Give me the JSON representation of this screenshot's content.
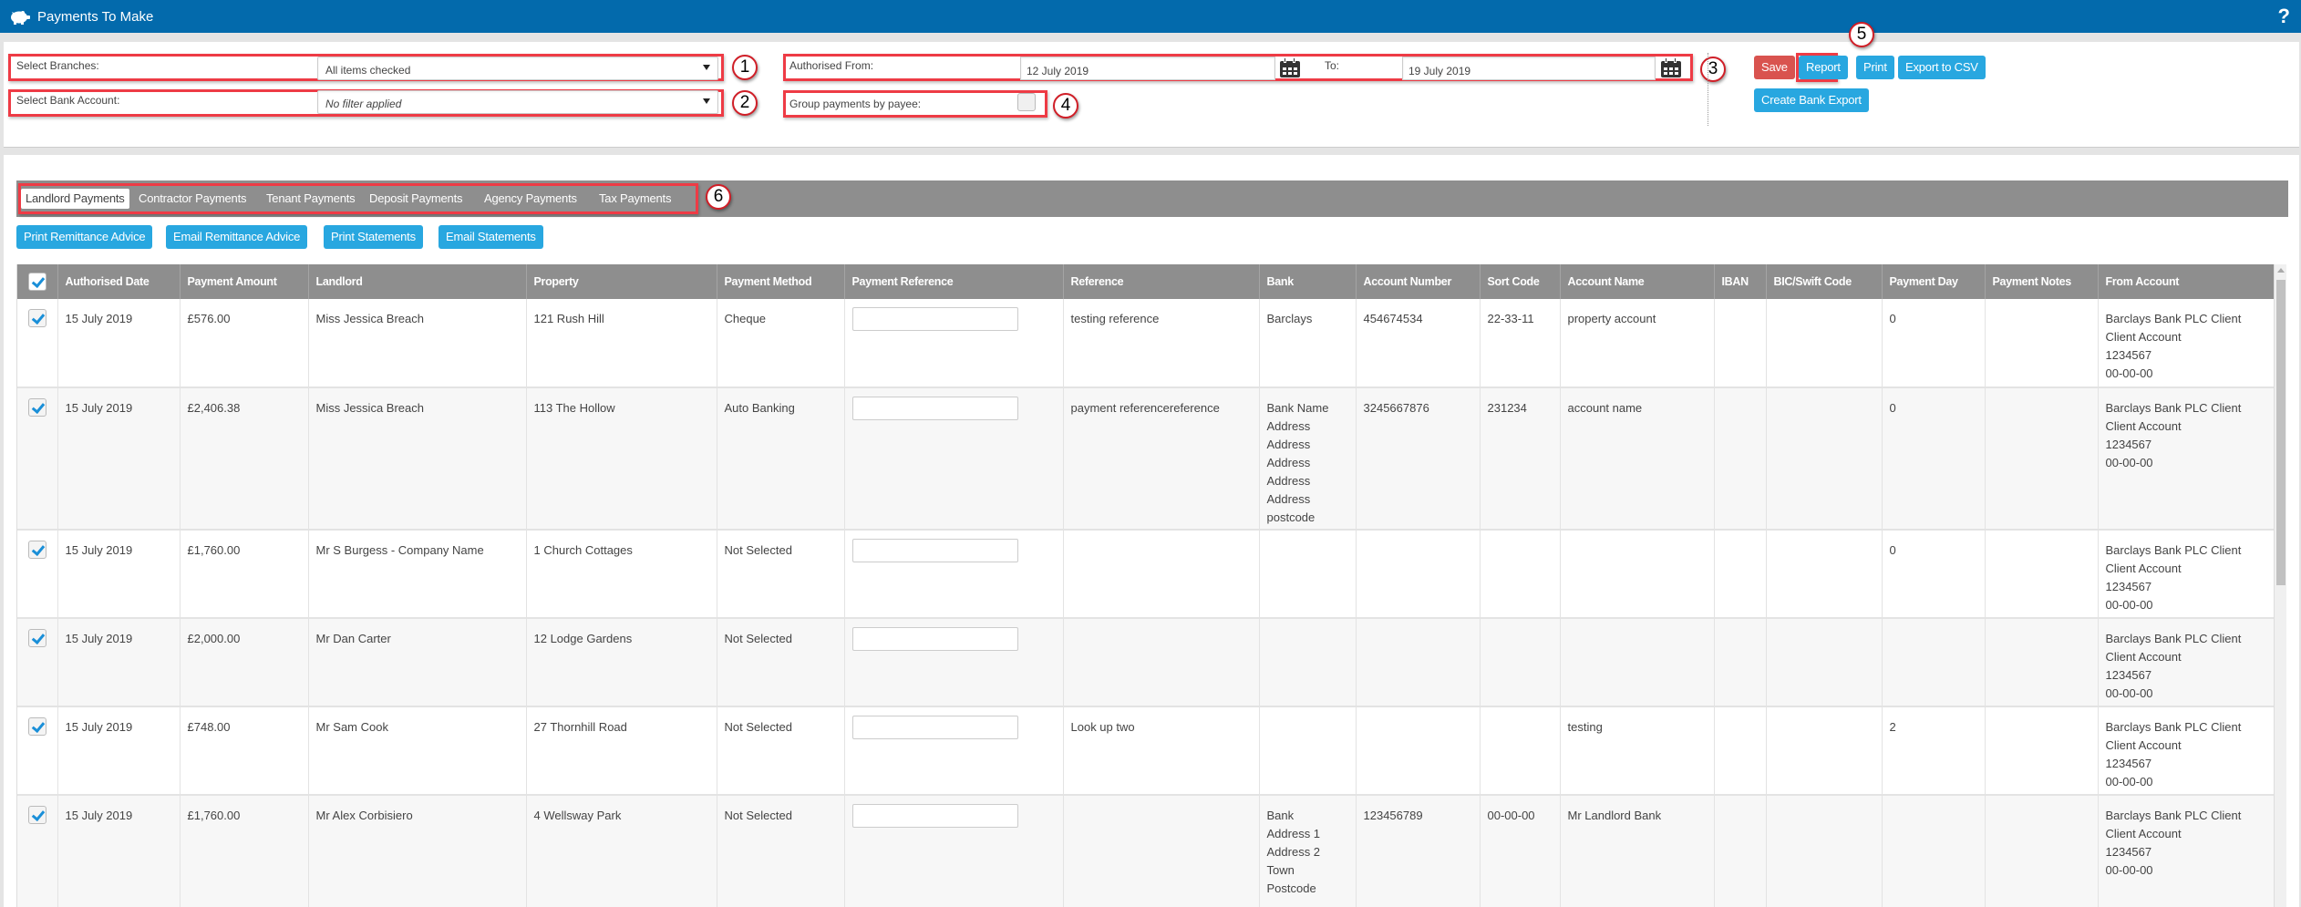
{
  "header": {
    "title": "Payments To Make",
    "app_icon": "piggy-bank-icon",
    "help_label": "?"
  },
  "filters": {
    "branches_label": "Select Branches:",
    "branches_value": "All items checked",
    "bank_account_label": "Select Bank Account:",
    "bank_account_value": "No filter applied",
    "authorised_from_label": "Authorised From:",
    "authorised_from_value": "12 July 2019",
    "to_label": "To:",
    "to_value": "19 July 2019",
    "group_by_payee_label": "Group payments by payee:",
    "group_by_payee_checked": false
  },
  "toolbar": {
    "save": "Save",
    "report": "Report",
    "print": "Print",
    "export_csv": "Export to CSV",
    "create_bank_export": "Create Bank Export"
  },
  "annotations": [
    "1",
    "2",
    "3",
    "4",
    "5",
    "6"
  ],
  "tabs": [
    {
      "label": "Landlord Payments",
      "active": true
    },
    {
      "label": "Contractor Payments",
      "active": false
    },
    {
      "label": "Tenant Payments",
      "active": false
    },
    {
      "label": "Deposit Payments",
      "active": false
    },
    {
      "label": "Agency Payments",
      "active": false
    },
    {
      "label": "Tax Payments",
      "active": false
    }
  ],
  "actions": {
    "print_remittance": "Print Remittance Advice",
    "email_remittance": "Email Remittance Advice",
    "print_statements": "Print Statements",
    "email_statements": "Email Statements"
  },
  "table": {
    "columns": [
      "Authorised Date",
      "Payment Amount",
      "Landlord",
      "Property",
      "Payment Method",
      "Payment Reference",
      "Reference",
      "Bank",
      "Account Number",
      "Sort Code",
      "Account Name",
      "IBAN",
      "BIC/Swift Code",
      "Payment Day",
      "Payment Notes",
      "From Account"
    ],
    "select_all_checked": true,
    "rows": [
      {
        "checked": true,
        "date": "15 July 2019",
        "amount": "£576.00",
        "landlord": "Miss Jessica Breach",
        "property": "121 Rush Hill",
        "method": "Cheque",
        "payment_reference": "",
        "reference": "testing reference",
        "bank": [
          "Barclays"
        ],
        "account_number": "454674534",
        "sort_code": "22-33-11",
        "account_name": "property account",
        "iban": "",
        "bic": "",
        "payment_day": "0",
        "notes": "",
        "from_account": [
          "Barclays Bank PLC Client",
          "Client Account",
          "1234567",
          "00-00-00"
        ]
      },
      {
        "checked": true,
        "date": "15 July 2019",
        "amount": "£2,406.38",
        "landlord": "Miss Jessica Breach",
        "property": "113 The Hollow",
        "method": "Auto Banking",
        "payment_reference": "",
        "reference": "payment referencereference",
        "bank": [
          "Bank Name",
          "Address",
          "Address",
          "Address",
          "Address",
          "Address",
          "postcode"
        ],
        "account_number": "3245667876",
        "sort_code": "231234",
        "account_name": "account name",
        "iban": "",
        "bic": "",
        "payment_day": "0",
        "notes": "",
        "from_account": [
          "Barclays Bank PLC Client",
          "Client Account",
          "1234567",
          "00-00-00"
        ]
      },
      {
        "checked": true,
        "date": "15 July 2019",
        "amount": "£1,760.00",
        "landlord": "Mr S Burgess - Company Name",
        "property": "1 Church Cottages",
        "method": "Not Selected",
        "payment_reference": "",
        "reference": "",
        "bank": [],
        "account_number": "",
        "sort_code": "",
        "account_name": "",
        "iban": "",
        "bic": "",
        "payment_day": "0",
        "notes": "",
        "from_account": [
          "Barclays Bank PLC Client",
          "Client Account",
          "1234567",
          "00-00-00"
        ]
      },
      {
        "checked": true,
        "date": "15 July 2019",
        "amount": "£2,000.00",
        "landlord": "Mr Dan Carter",
        "property": "12 Lodge Gardens",
        "method": "Not Selected",
        "payment_reference": "",
        "reference": "",
        "bank": [],
        "account_number": "",
        "sort_code": "",
        "account_name": "",
        "iban": "",
        "bic": "",
        "payment_day": "",
        "notes": "",
        "from_account": [
          "Barclays Bank PLC Client",
          "Client Account",
          "1234567",
          "00-00-00"
        ]
      },
      {
        "checked": true,
        "date": "15 July 2019",
        "amount": "£748.00",
        "landlord": "Mr Sam Cook",
        "property": "27 Thornhill Road",
        "method": "Not Selected",
        "payment_reference": "",
        "reference": "Look up two",
        "bank": [],
        "account_number": "",
        "sort_code": "",
        "account_name": "testing",
        "iban": "",
        "bic": "",
        "payment_day": "2",
        "notes": "",
        "from_account": [
          "Barclays Bank PLC Client",
          "Client Account",
          "1234567",
          "00-00-00"
        ]
      },
      {
        "checked": true,
        "date": "15 July 2019",
        "amount": "£1,760.00",
        "landlord": "Mr Alex Corbisiero",
        "property": "4 Wellsway Park",
        "method": "Not Selected",
        "payment_reference": "",
        "reference": "",
        "bank": [
          "Bank",
          "Address 1",
          "Address 2",
          "Town",
          "Postcode"
        ],
        "account_number": "123456789",
        "sort_code": "00-00-00",
        "account_name": "Mr Landlord Bank",
        "iban": "",
        "bic": "",
        "payment_day": "",
        "notes": "",
        "from_account": [
          "Barclays Bank PLC Client",
          "Client Account",
          "1234567",
          "00-00-00"
        ]
      }
    ]
  },
  "colors": {
    "header_bar": "#036aac",
    "highlight_border": "#ee3b45",
    "save_button": "#d9534f",
    "primary_button": "#28a7e0",
    "table_header": "#8e8e8e"
  }
}
